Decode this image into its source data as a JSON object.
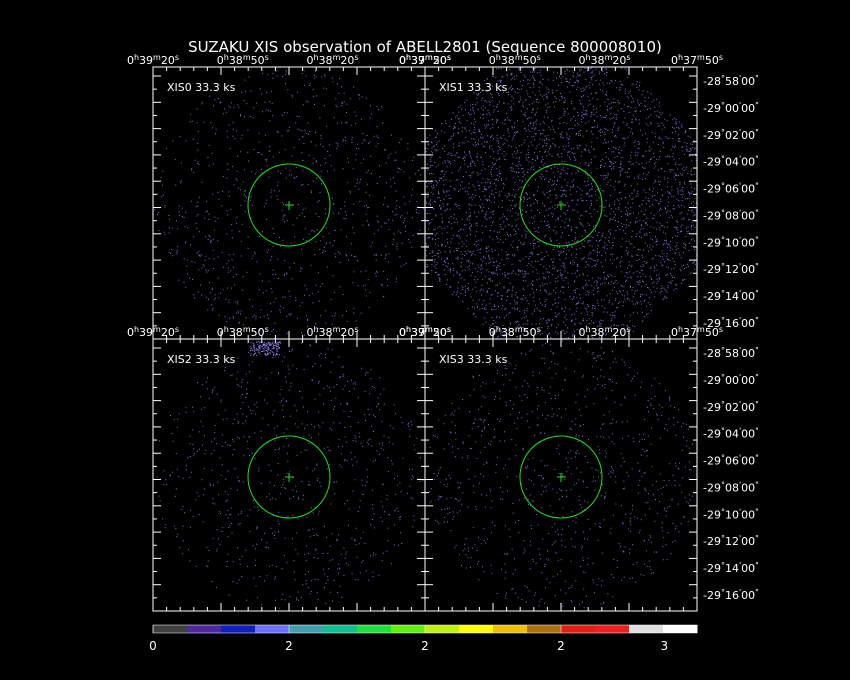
{
  "title": "SUZAKU XIS observation of ABELL2801  (Sequence 800008010)",
  "panels": [
    {
      "id": "xis0",
      "label": "XIS0 33.3 ks"
    },
    {
      "id": "xis1",
      "label": "XIS1 33.3 ks"
    },
    {
      "id": "xis2",
      "label": "XIS2 33.3 ks"
    },
    {
      "id": "xis3",
      "label": "XIS3 33.3 ks"
    }
  ],
  "ra_labels": [
    "0h39m20s",
    "0h38m50s",
    "0h38m20s",
    "0h37m50s"
  ],
  "dec_labels": [
    "-28°58'00\"",
    "-29°00'00\"",
    "-29°02'00\"",
    "-29°04'00\"",
    "-29°06'00\"",
    "-29°08'00\"",
    "-29°10'00\"",
    "-29°12'00\"",
    "-29°14'00\"",
    "-29°16'00\""
  ],
  "colorbar": {
    "colors": [
      "#404040",
      "#5028a0",
      "#1020c0",
      "#7070ff",
      "#40a0b0",
      "#10c090",
      "#20e040",
      "#60f010",
      "#c0f010",
      "#ffff00",
      "#f0c000",
      "#b07010",
      "#e02010",
      "#f02020",
      "#e0e0e0",
      "#ffffff"
    ],
    "ticks": [
      "0",
      "2",
      "2",
      "2",
      "3"
    ]
  },
  "colors": {
    "background": "#000000",
    "foreground": "#ffffff",
    "region": "#20e020",
    "events": "#7b73d8"
  }
}
